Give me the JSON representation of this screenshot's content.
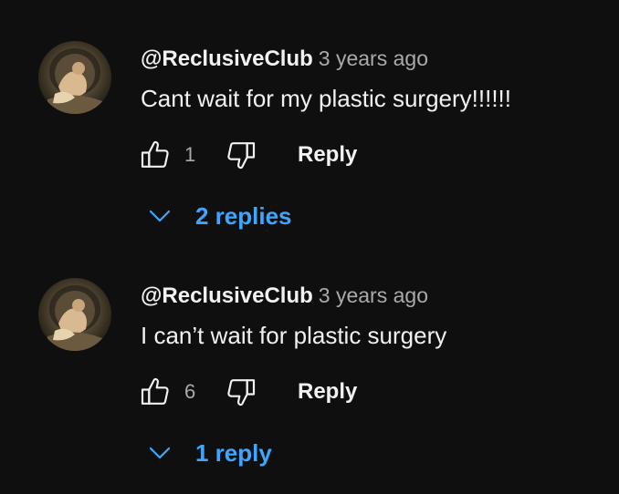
{
  "colors": {
    "background": "#0f0f0f",
    "text": "#f1f1f1",
    "secondary": "#aaaaaa",
    "link": "#3ea6ff"
  },
  "comments": [
    {
      "author": "@ReclusiveClub",
      "time": "3 years ago",
      "text": "Cant wait for my plastic surgery!!!!!!",
      "like_count": "1",
      "reply_label": "Reply",
      "replies_label": "2 replies",
      "avatar_icon": "avatar-image",
      "like_icon": "thumbs-up-icon",
      "dislike_icon": "thumbs-down-icon",
      "expand_icon": "chevron-down-icon"
    },
    {
      "author": "@ReclusiveClub",
      "time": "3 years ago",
      "text": "I can’t wait for plastic surgery",
      "like_count": "6",
      "reply_label": "Reply",
      "replies_label": "1 reply",
      "avatar_icon": "avatar-image",
      "like_icon": "thumbs-up-icon",
      "dislike_icon": "thumbs-down-icon",
      "expand_icon": "chevron-down-icon"
    }
  ]
}
